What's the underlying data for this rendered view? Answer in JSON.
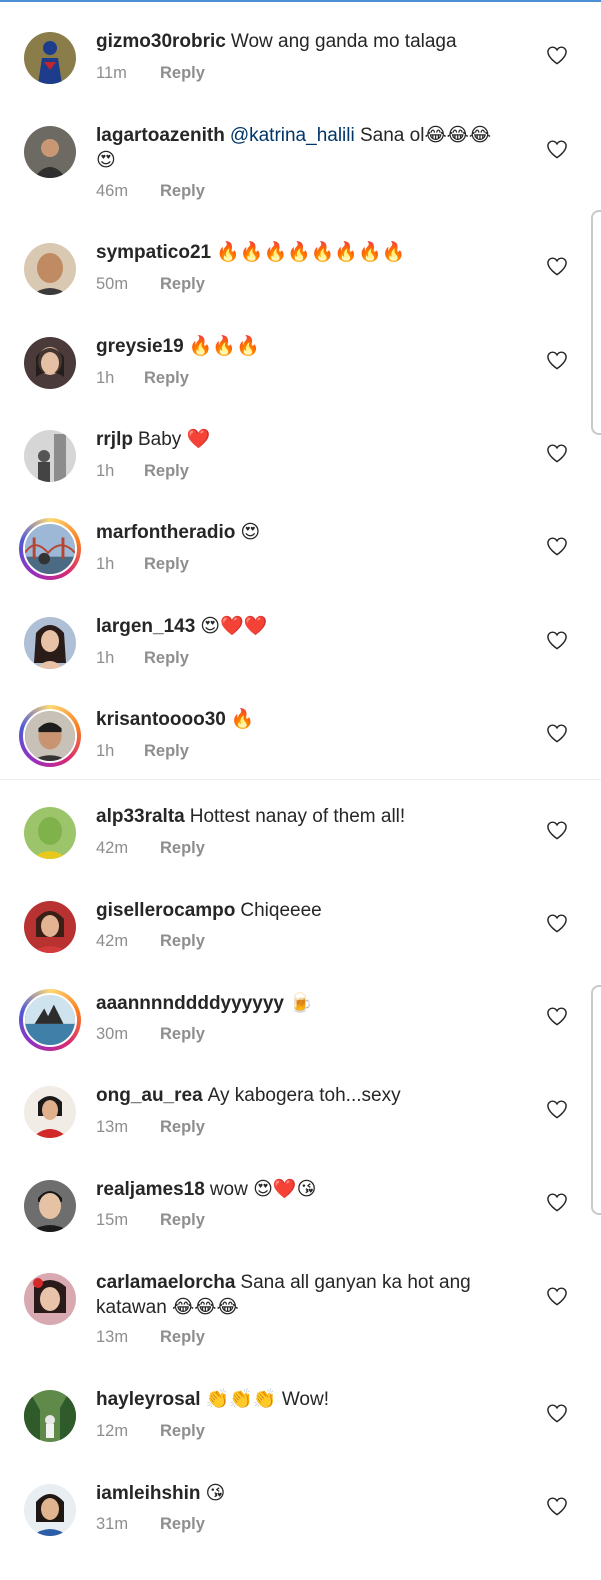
{
  "labels": {
    "reply": "Reply"
  },
  "colors": {
    "mention": "#003569",
    "meta": "#8e8e8e",
    "text": "#262626"
  },
  "comments": [
    {
      "user": "gizmo30robric",
      "text": "Wow ang ganda mo talaga",
      "time": "11m",
      "avatar_icon": "avatar-superhero-icon"
    },
    {
      "user": "lagartoazenith",
      "mention": "@katrina_halili",
      "text": "Sana ol😂😂😂 😍",
      "time": "46m",
      "avatar_icon": "avatar-man-icon"
    },
    {
      "user": "sympatico21",
      "text": "🔥🔥🔥🔥🔥🔥🔥🔥",
      "time": "50m",
      "avatar_icon": "avatar-bald-man-icon"
    },
    {
      "user": "greysie19",
      "text": "🔥🔥🔥",
      "time": "1h",
      "avatar_icon": "avatar-woman-icon"
    },
    {
      "user": "rrjlp",
      "text": "Baby ❤️",
      "time": "1h",
      "avatar_icon": "avatar-bw-photo-icon"
    },
    {
      "user": "marfontheradio",
      "text": "😍",
      "time": "1h",
      "avatar_icon": "avatar-bridge-icon"
    },
    {
      "user": "largen_143",
      "text": "😍❤️❤️",
      "time": "1h",
      "avatar_icon": "avatar-woman-icon"
    },
    {
      "user": "krisantoooo30",
      "text": "🔥",
      "time": "1h",
      "avatar_icon": "avatar-man-icon"
    },
    {
      "user": "alp33ralta",
      "text": "Hottest nanay of them all!",
      "time": "42m",
      "avatar_icon": "avatar-green-face-icon"
    },
    {
      "user": "gisellerocampo",
      "text": "Chiqeeee",
      "time": "42m",
      "avatar_icon": "avatar-woman-icon"
    },
    {
      "user": "aaannnnddddyyyyyy",
      "text": "🍺",
      "time": "30m",
      "avatar_icon": "avatar-landscape-icon"
    },
    {
      "user": "ong_au_rea",
      "text": "Ay kabogera toh...sexy",
      "time": "13m",
      "avatar_icon": "avatar-woman-red-icon"
    },
    {
      "user": "realjames18",
      "text": "wow 😍❤️😘",
      "time": "15m",
      "avatar_icon": "avatar-young-man-icon"
    },
    {
      "user": "carlamaelorcha",
      "text": "Sana all ganyan ka hot ang katawan 😂😂😂",
      "time": "13m",
      "avatar_icon": "avatar-woman-icon"
    },
    {
      "user": "hayleyrosal",
      "text": "👏👏👏 Wow!",
      "time": "12m",
      "avatar_icon": "avatar-forest-icon"
    },
    {
      "user": "iamleihshin",
      "text": "😘",
      "time": "31m",
      "avatar_icon": "avatar-woman-icon"
    }
  ]
}
